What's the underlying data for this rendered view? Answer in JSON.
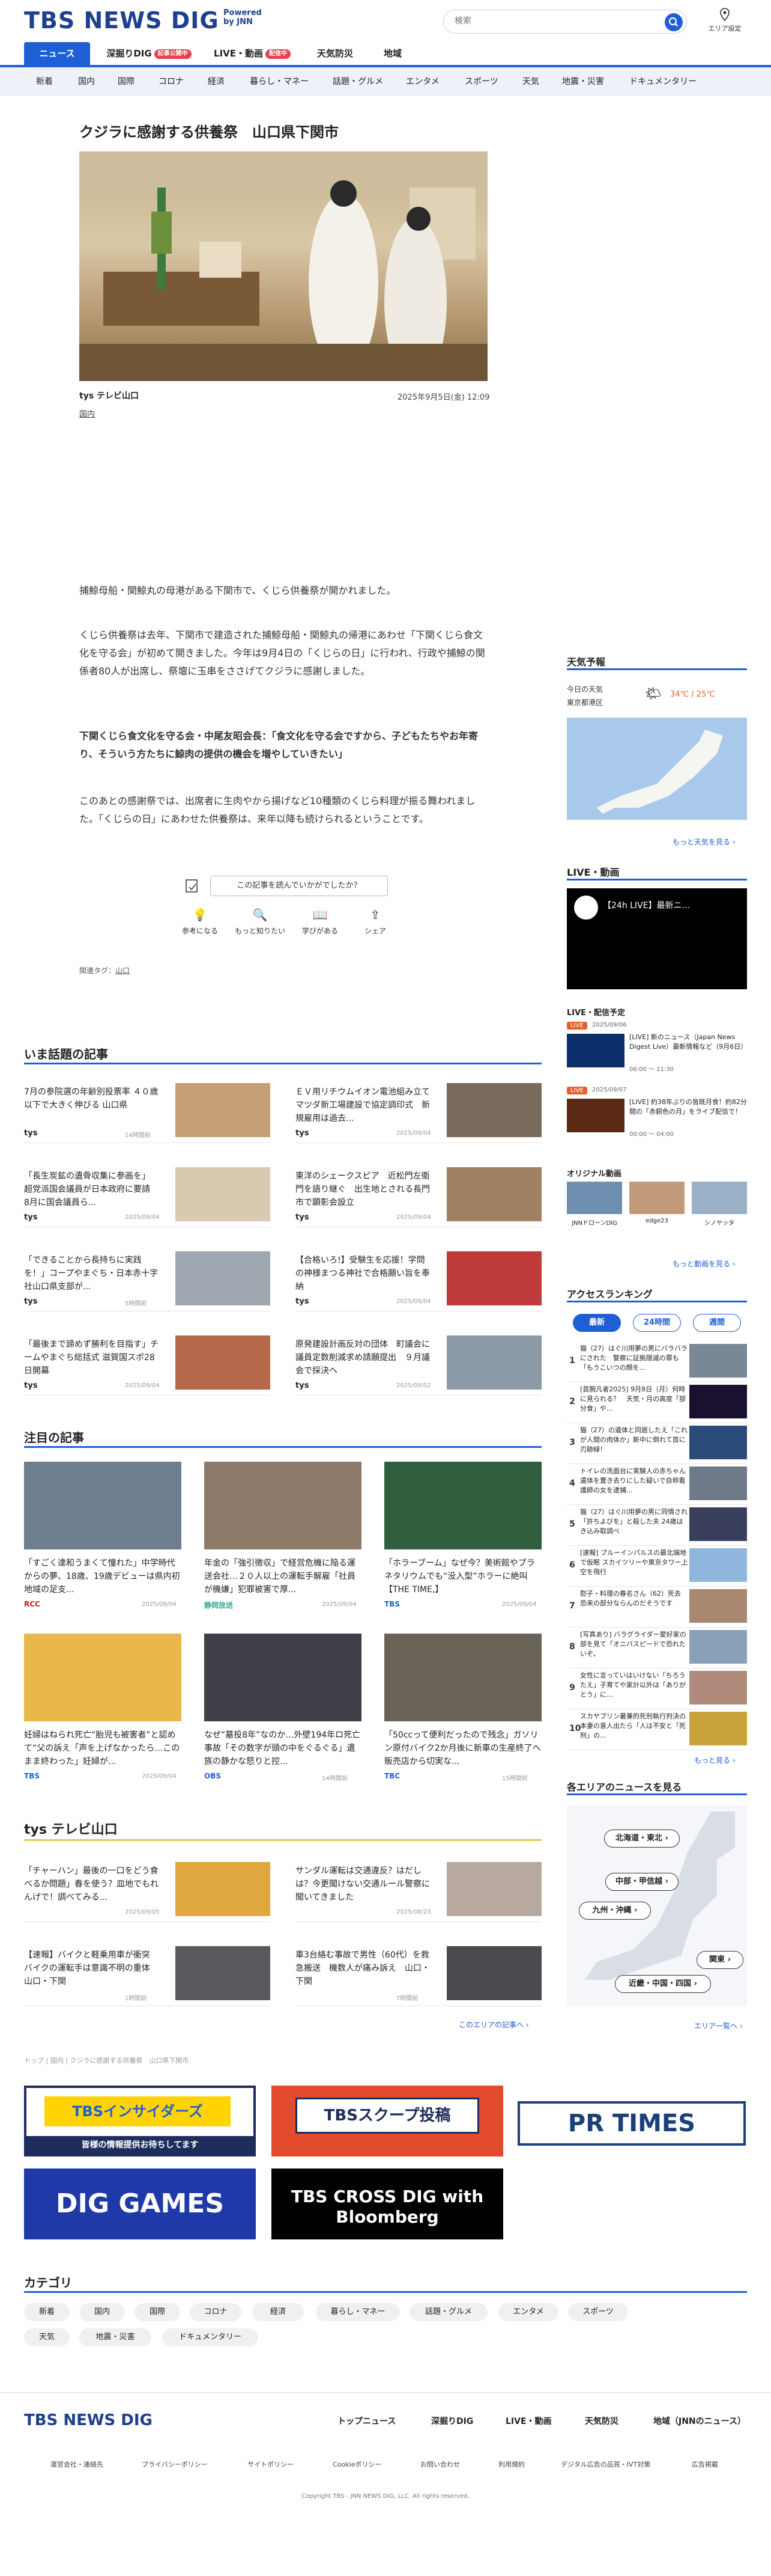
{
  "header": {
    "logo": "TBS NEWS DIG",
    "logo_sub": "Powered by JNN",
    "search_placeholder": "検索",
    "area_setting": "エリア設定",
    "gnav": [
      {
        "label": "ニュース",
        "badge": ""
      },
      {
        "label": "深掘りDIG",
        "badge": "記事公開中"
      },
      {
        "label": "LIVE・動画",
        "badge": "配信中"
      },
      {
        "label": "天気防災",
        "badge": ""
      },
      {
        "label": "地域",
        "badge": ""
      }
    ],
    "subnav": [
      "新着",
      "国内",
      "国際",
      "コロナ",
      "経済",
      "暮らし・マネー",
      "話題・グルメ",
      "エンタメ",
      "スポーツ",
      "天気",
      "地震・災害",
      "ドキュメンタリー"
    ]
  },
  "article": {
    "title": "クジラに感謝する供養祭　山口県下関市",
    "source": "tys テレビ山口",
    "date": "2025年9月5日(金) 12:09",
    "category": "国内",
    "paragraphs": [
      "捕鯨母船・関鯨丸の母港がある下関市で、くじら供養祭が開かれました。",
      "くじら供養祭は去年、下関市で建造された捕鯨母船・関鯨丸の帰港にあわせ「下関くじら食文化を守る会」が初めて開きました。今年は9月4日の「くじらの日」に行われ、行政や捕鯨の関係者80人が出席し、祭壇に玉串をささげてクジラに感謝しました。",
      "下関くじら食文化を守る会・中尾友昭会長：「食文化を守る会ですから、子どもたちやお年寄り、そういう方たちに鯨肉の提供の機会を増やしていきたい」",
      "このあとの感謝祭では、出席者に生肉やから揚げなど10種類のくじら料理が振る舞われました。「くじらの日」にあわせた供養祭は、来年以降も続けられるということです。"
    ],
    "feedback_q": "この記事を読んでいかがでしたか？",
    "feedback": [
      "参考になる",
      "もっと知りたい",
      "学びがある",
      "シェア"
    ],
    "tags_label": "関連タグ：",
    "tag": "山口"
  },
  "trending": {
    "heading": "いま話題の記事",
    "items": [
      {
        "title": "7月の参院選の年齢別投票率 ４０歳以下で大きく伸びる 山口県",
        "source": "tys",
        "date": "14時間前"
      },
      {
        "title": "ＥＶ用リチウムイオン電池組み立てマツダ新工場建設で協定調印式　新規雇用は過去...",
        "source": "tys",
        "date": "2025/09/04"
      },
      {
        "title": "「長生炭鉱の遺骨収集に参画を」 超党派国会議員が日本政府に要請　8月に国会議員ら...",
        "source": "tys",
        "date": "2025/09/04"
      },
      {
        "title": "東洋のシェークスピア　近松門左衛門を語り継ぐ　出生地とされる長門市で顕彰会設立",
        "source": "tys",
        "date": "2025/09/04"
      },
      {
        "title": "「できることから長持ちに実践を！」コープやまぐち・日本赤十字社山口県支部が...",
        "source": "tys",
        "date": "5時間前"
      },
      {
        "title": "【合格いろ!】受験生を応援！学問の神様まつる神社で合格願い旨を奉納",
        "source": "tys",
        "date": "2025/09/04"
      },
      {
        "title": "「最後まで諦めず勝利を目指す」チームやまぐち総括式 滋賀国スポ28日開幕",
        "source": "tys",
        "date": "2025/09/04"
      },
      {
        "title": "原発建設計画反対の団体　町議会に議員定数削減求め請願提出　９月議会で採決へ",
        "source": "tys",
        "date": "2025/09/02"
      }
    ]
  },
  "featured": {
    "heading": "注目の記事",
    "items": [
      {
        "title": "「すごく達和うまくて憧れた」中学時代からの夢、18歳、19歳デビューは県内初　地域の足支...",
        "source": "RCC",
        "date": "2025/09/04"
      },
      {
        "title": "年金の「強引徴収」で経営危機に陥る運送会社…２０人以上の運転手解雇「社員が機嫌」犯罪被害で厚...",
        "source": "静岡放送",
        "date": "2025/09/04"
      },
      {
        "title": "「ホラーブーム」なぜ今？美術館やプラネタリウムでも“没入型”ホラーに絶叫【THE TIME,】",
        "source": "TBS",
        "date": "2025/09/04"
      },
      {
        "title": "妊婦はねられ死亡“胎児も被害者”と認めて“父の訴え「声を上げなかったら…このまま終わった」妊婦が...",
        "source": "TBS",
        "date": "2025/09/04"
      },
      {
        "title": "なぜ“墓投8年”なのか…外壁194年ロ死亡事故「その数字が頭の中をぐるぐる」遺族の静かな怒りと控...",
        "source": "OBS",
        "date": "14時間前"
      },
      {
        "title": "「50ccって便利だったので残念」ガソリン原付バイク2か月後に新車の生産終了へ 販売店から切実な...",
        "source": "TBC",
        "date": "15時間前"
      }
    ]
  },
  "local": {
    "station": "tys テレビ山口",
    "items": [
      {
        "title": "「チャーハン」最後の一口をどう食べるか問題」春を使う？皿地でもれんげで！調べてみる...",
        "date": "2025/09/05"
      },
      {
        "title": "サンダル運転は交通違反？はだしは？今更聞けない交通ルール警察に聞いてきました",
        "date": "2025/08/23"
      },
      {
        "title": "【速報】バイクと軽乗用車が衝突　バイクの運転手は意識不明の重体　山口・下関",
        "date": "1時間前"
      },
      {
        "title": "車3台絡む事故で男性（60代）を救急搬送　機数人が痛み訴え　山口・下関",
        "date": "7時間前"
      }
    ],
    "more": "このエリアの記事へ ›"
  },
  "breadcrumb": "トップ | 国内 | クジラに感謝する供養祭　山口県下関市",
  "banners": [
    "TBSインサイダーズ",
    "皆様の情報提供お待ちしてます",
    "TBSスクープ投稿",
    "PR TIMES",
    "DIG GAMES",
    "TBS CROSS DIG with Bloomberg"
  ],
  "categories": {
    "heading": "カテゴリ",
    "items": [
      "新着",
      "国内",
      "国際",
      "コロナ",
      "経済",
      "暮らし・マネー",
      "話題・グルメ",
      "エンタメ",
      "スポーツ",
      "天気",
      "地震・災害",
      "ドキュメンタリー"
    ]
  },
  "footer": {
    "links": [
      "トップニュース",
      "深掘りDIG",
      "LIVE・動画",
      "天気防災",
      "地域（JNNのニュース）"
    ],
    "small": [
      "運営会社・連絡先",
      "プライバシーポリシー",
      "サイトポリシー",
      "Cookieポリシー",
      "お問い合わせ",
      "利用規約",
      "デジタル広告の品質・IVT対策",
      "広告掲載"
    ],
    "copyright": "Copyright TBS - JNN NEWS DIG, LLC. All rights reserved."
  },
  "sidebar": {
    "weather": {
      "heading": "天気予報",
      "today": "今日の天気",
      "region": "東京都港区",
      "temp": "34℃ / 25℃",
      "more": "もっと天気を見る ›"
    },
    "live": {
      "heading": "LIVE・動画",
      "video_title": "【24h LIVE】最新ニ...",
      "schedule": "LIVE・配信予定",
      "items": [
        {
          "date": "2025/09/06",
          "text": "[LIVE] 新のニュース（Japan News Digest Live）最新情報など（9月6日）",
          "time": "06:00 ～ 11:30"
        },
        {
          "date": "2025/09/07",
          "text": "[LIVE] 約38年ぶりの皆既月食！約82分間の「赤銅色の月」をライブ配信で！",
          "time": "00:00 ～ 04:00"
        }
      ],
      "original": "オリジナル動画",
      "channels": [
        "JNNドローンDIG",
        "edge23",
        "シノヤッタ"
      ],
      "more": "もっと動画を見る ›"
    },
    "ranking": {
      "heading": "アクセスランキング",
      "tabs": [
        "最新",
        "24時間",
        "週間"
      ],
      "items": [
        "猫（27）はぐ川用夢の男にバラバラにされた　警察に証拠隠滅の罪も「もうこいつの顔を...",
        "[首腕凡者2025] 9月8日（月）何時に見られる？　天気・月の高度「部分食」や...",
        "猫（27）の遺体と同居したえ「これが人間の肉体か」新中に倒れて首に刃跡緑！",
        "トイレの洗面台に実験人の赤ちゃん遺体を置き去りにした疑いで自称看護師の女を逮捕...",
        "猫（27）はぐ川用夢の男に同情され「許ちよびを」と殺した夫 24歳はき込み取調べ",
        "[速報] プルーインパルスの最北端地で仮眠 スカイツリーや東京タワー上空を飛行",
        "慰子・料理の春名さん（62）死去 恐来の部分ならんのだそうです",
        "[写真あり] バラグライダー愛好家の部を見て「オニバスピードで恐れたいぞ。",
        "女性に言っていはいけない「ちろうたえ」子育てや家計以外は「ありがとう」に...",
        "スカヤプリン暑兼的死刑執行判決の本妻の意人出たら「人は不安と「死刑」の..."
      ],
      "more": "もっと見る ›"
    },
    "area": {
      "heading": "各エリアのニュースを見る",
      "regions": [
        "北海道・東北 ›",
        "中部・甲信越 ›",
        "九州・沖縄 ›",
        "関東 ›",
        "近畿・中国・四国 ›"
      ],
      "more": "エリア一覧へ ›"
    }
  },
  "colors": {
    "brand": "#1f3f8f",
    "accent": "#1f5fd6",
    "live": "#e8404f"
  }
}
